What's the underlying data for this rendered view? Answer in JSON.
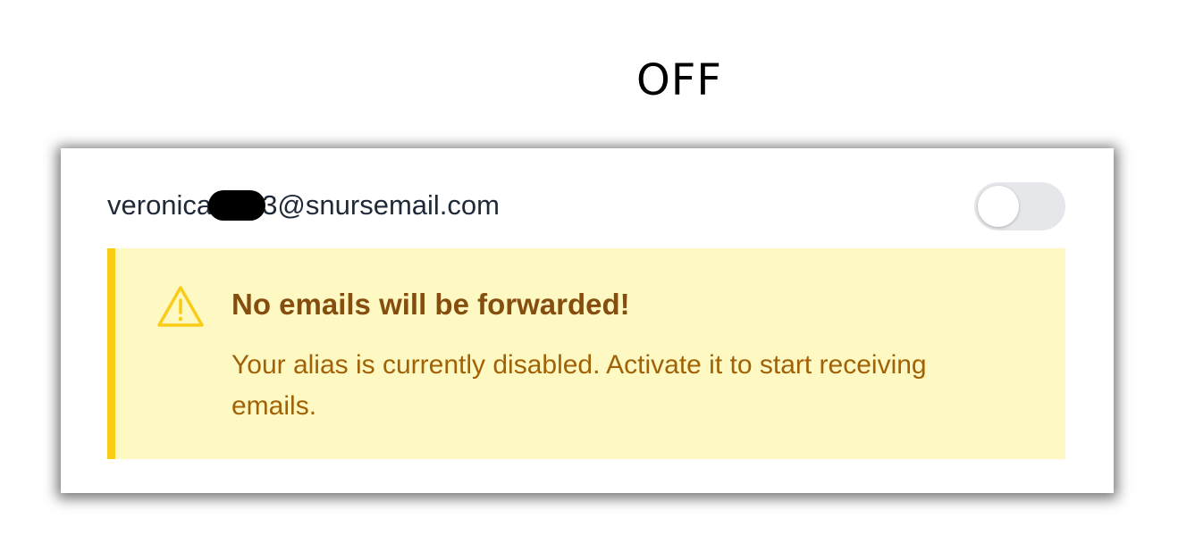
{
  "annotation": {
    "state_label": "OFF"
  },
  "alias": {
    "email_prefix": "veronica",
    "email_suffix": "3@snursemail.com",
    "toggle_state": "off"
  },
  "alert": {
    "icon": "warning-icon",
    "title": "No emails will be forwarded!",
    "message": "Your alias is currently disabled. Activate it to start receiving emails."
  },
  "colors": {
    "alert_background": "#fef9c3",
    "alert_border": "#facc15",
    "alert_title": "#854d0e",
    "alert_text": "#a16207",
    "toggle_off": "#e5e7eb"
  }
}
